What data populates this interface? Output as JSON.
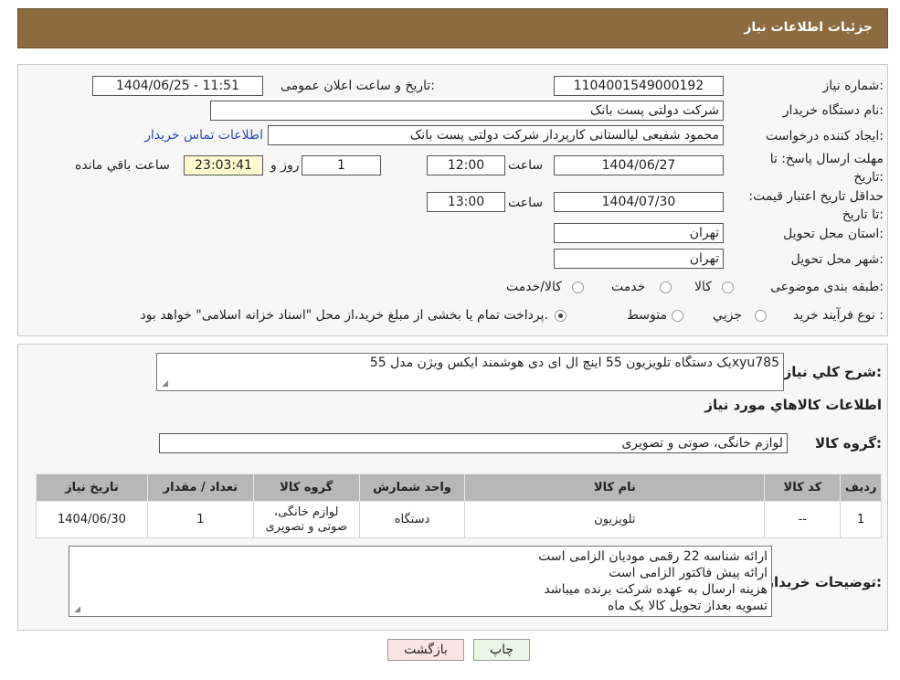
{
  "header": {
    "title": "جزئیات اطلاعات نیاز"
  },
  "fields": {
    "need_number_label": "شماره نیاز:",
    "need_number": "1104001549000192",
    "announce_label": "تاریخ و ساعت اعلان عمومی:",
    "announce_value": "1404/06/25 - 11:51",
    "buyer_org_label": "نام دستگاه خریدار:",
    "buyer_org": "شرکت دولتی پست بانک",
    "requester_label": "ایجاد کننده درخواست:",
    "requester": "محمود شفیعی لیالستانی کارپرداز شرکت دولتی پست بانک",
    "contact_link": "اطلاعات تماس خریدار",
    "reply_deadline_label": "مهلت ارسال پاسخ: تا تاریخ:",
    "reply_deadline_date": "1404/06/27",
    "time_label": "ساعت",
    "reply_deadline_time": "12:00",
    "days_value": "1",
    "days_label": "روز و",
    "remaining_time": "23:03:41",
    "remaining_label": "ساعت باقي مانده",
    "price_validity_label": "حداقل تاریخ اعتبار قیمت: تا تاریخ:",
    "price_validity_date": "1404/07/30",
    "price_validity_time": "13:00",
    "province_label": "استان محل تحویل:",
    "province": "تهران",
    "city_label": "شهر محل تحویل:",
    "city": "تهران",
    "category_label": "طبقه بندی موضوعی:",
    "category_options": [
      "کالا",
      "خدمت",
      "کالا/خدمت"
    ],
    "process_label": "نوع فرآیند خرید :",
    "process_options": [
      "جزیي",
      "متوسط"
    ],
    "process_note": "پرداخت تمام یا بخشی از مبلغ خرید،از محل \"اسناد خزانه اسلامی\" خواهد بود."
  },
  "summary": {
    "label": "شرح كلي نياز:",
    "text": "یک دستگاه تلویزیون 55 اینچ ال ای دی هوشمند ایکس ویژن مدل 55xyu785",
    "goods_info_title": "اطلاعات كالاهاي مورد نياز",
    "group_label": "گروه كالا:",
    "group_value": "لوازم خانگی، صوتی و تصویری"
  },
  "table": {
    "headers": [
      "رديف",
      "کد کالا",
      "نام کالا",
      "واحد شمارش",
      "گروه کالا",
      "تعداد / مقدار",
      "تاریخ نیاز"
    ],
    "rows": [
      [
        "1",
        "--",
        "تلویزیون",
        "دستگاه",
        "لوازم خانگی، صوتی و تصویری",
        "1",
        "1404/06/30"
      ]
    ]
  },
  "buyer_notes": {
    "label": "توضیحات خریدار:",
    "lines": [
      "ارائه شناسه 22 رقمی مودیان الزامی است",
      "ارائه پیش فاکتور الزامی است",
      "هزینه ارسال به  عهده شرکت برنده میباشد",
      "تسویه بعداز تحویل کالا یک ماه"
    ]
  },
  "buttons": {
    "print": "چاپ",
    "back": "بازگشت"
  },
  "colors": {
    "header": "#8b6b3f",
    "table_header": "#b7b7b7",
    "timer_bg": "#fffbd0"
  }
}
